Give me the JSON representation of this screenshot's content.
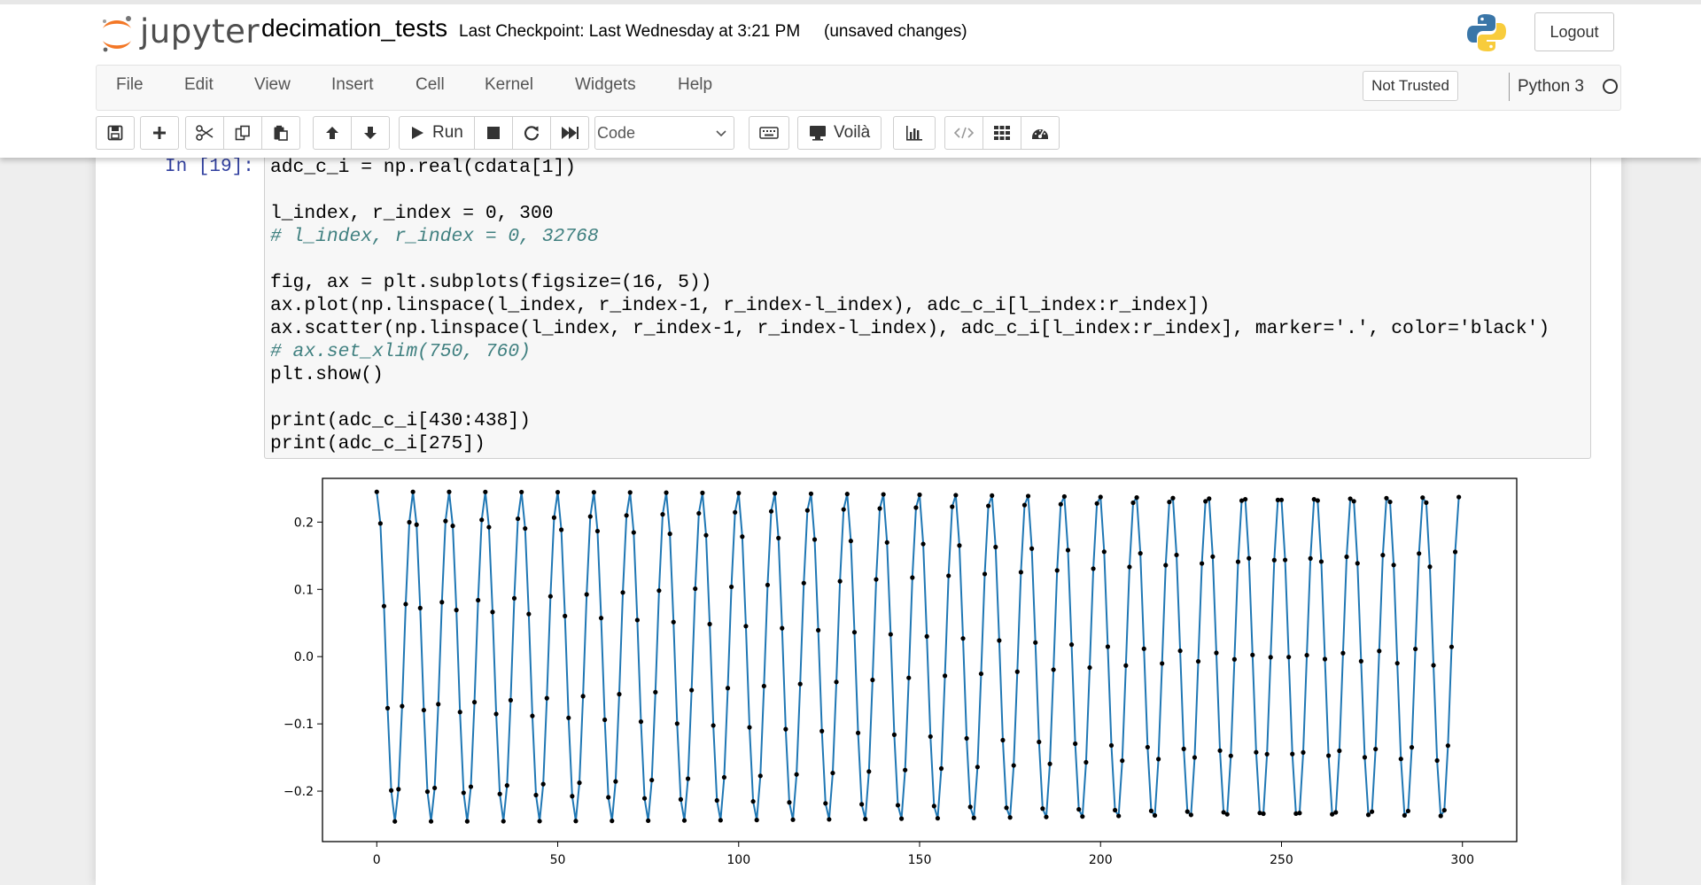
{
  "header": {
    "logo_text": "jupyter",
    "notebook_name": "decimation_tests",
    "checkpoint": "Last Checkpoint: Last Wednesday at 3:21 PM",
    "status": "(unsaved changes)",
    "logout_label": "Logout"
  },
  "menubar": {
    "items": [
      "File",
      "Edit",
      "View",
      "Insert",
      "Cell",
      "Kernel",
      "Widgets",
      "Help"
    ],
    "trust_label": "Not Trusted",
    "kernel_name": "Python 3"
  },
  "toolbar": {
    "run_label": "Run",
    "cell_type": "Code",
    "voila_label": "Voilà"
  },
  "cell": {
    "prompt": "In [19]:",
    "code": [
      "adc_c_i = np.real(cdata[1])",
      "",
      "l_index, r_index = 0, 300",
      "# l_index, r_index = 0, 32768",
      "",
      "fig, ax = plt.subplots(figsize=(16, 5))",
      "ax.plot(np.linspace(l_index, r_index-1, r_index-l_index), adc_c_i[l_index:r_index])",
      "ax.scatter(np.linspace(l_index, r_index-1, r_index-l_index), adc_c_i[l_index:r_index], marker='.', color='black')",
      "# ax.set_xlim(750, 760)",
      "plt.show()",
      "",
      "print(adc_c_i[430:438])",
      "print(adc_c_i[275])"
    ]
  },
  "chart_data": {
    "type": "line",
    "xlim": [
      -15,
      315
    ],
    "ylim": [
      -0.275,
      0.265
    ],
    "x_ticks": [
      0,
      50,
      100,
      150,
      200,
      250,
      300
    ],
    "y_ticks": [
      0.2,
      0.1,
      0.0,
      -0.1,
      -0.2
    ],
    "x_tick_labels": [
      "0",
      "50",
      "100",
      "150",
      "200",
      "250",
      "300"
    ],
    "y_tick_labels": [
      "0.2",
      "0.1",
      "0.0",
      "−0.1",
      "−0.2"
    ],
    "series_color": "#1f77b4",
    "marker_color": "#000000",
    "signal": {
      "n_points": 300,
      "amplitude": 0.245,
      "cycles_per_sample": 0.1002,
      "phase": 0.0
    }
  }
}
